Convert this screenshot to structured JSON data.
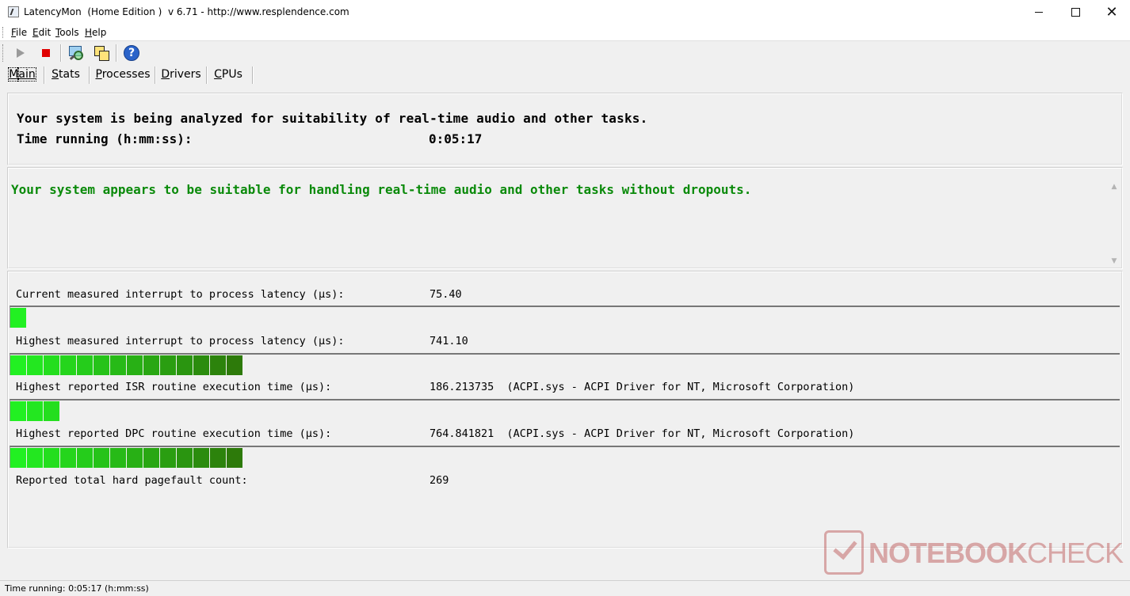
{
  "window": {
    "title": "LatencyMon  (Home Edition )  v 6.71 - http://www.resplendence.com"
  },
  "menu": [
    {
      "prefix": "",
      "accel": "F",
      "rest": "ile"
    },
    {
      "prefix": "",
      "accel": "E",
      "rest": "dit"
    },
    {
      "prefix": "",
      "accel": "T",
      "rest": "ools"
    },
    {
      "prefix": "",
      "accel": "H",
      "rest": "elp"
    }
  ],
  "toolbar": {
    "icons": [
      "play-icon",
      "stop-icon",
      "analyze-icon",
      "windows-icon",
      "help-icon"
    ]
  },
  "tabs": [
    {
      "accel": "M",
      "rest": "ain",
      "active": true
    },
    {
      "accel": "S",
      "rest": "tats",
      "active": false
    },
    {
      "accel": "P",
      "rest": "rocesses",
      "active": false
    },
    {
      "accel": "D",
      "rest": "rivers",
      "active": false
    },
    {
      "accel": "C",
      "rest": "PUs",
      "active": false
    }
  ],
  "main": {
    "status_line": "Your system is being analyzed for suitability of real-time audio and other tasks.",
    "time_label": "Time running (h:mm:ss):",
    "time_value": "0:05:17",
    "verdict": "Your system appears to be suitable for handling real-time audio and other tasks without dropouts.",
    "verdict_color": "#0a8a0a"
  },
  "metrics": [
    {
      "label": "Current measured interrupt to process latency (µs):",
      "value": "75.40",
      "meter_segments": 1
    },
    {
      "label": "Highest measured interrupt to process latency (µs):",
      "value": "741.10",
      "meter_segments": 14
    },
    {
      "label": "Highest reported ISR routine execution time (µs):",
      "value": "186.213735  (ACPI.sys - ACPI Driver for NT, Microsoft Corporation)",
      "meter_segments": 3
    },
    {
      "label": "Highest reported DPC routine execution time (µs):",
      "value": "764.841821  (ACPI.sys - ACPI Driver for NT, Microsoft Corporation)",
      "meter_segments": 14
    },
    {
      "label": "Reported total hard pagefault count:",
      "value": "269"
    }
  ],
  "statusbar": {
    "text": "Time running: 0:05:17  (h:mm:ss)"
  },
  "watermark": {
    "text_bold": "NOTEBOOK",
    "text_light": "CHECK"
  },
  "colors": {
    "meter_start": "#22f022",
    "meter_end": "#2d7a0a"
  }
}
